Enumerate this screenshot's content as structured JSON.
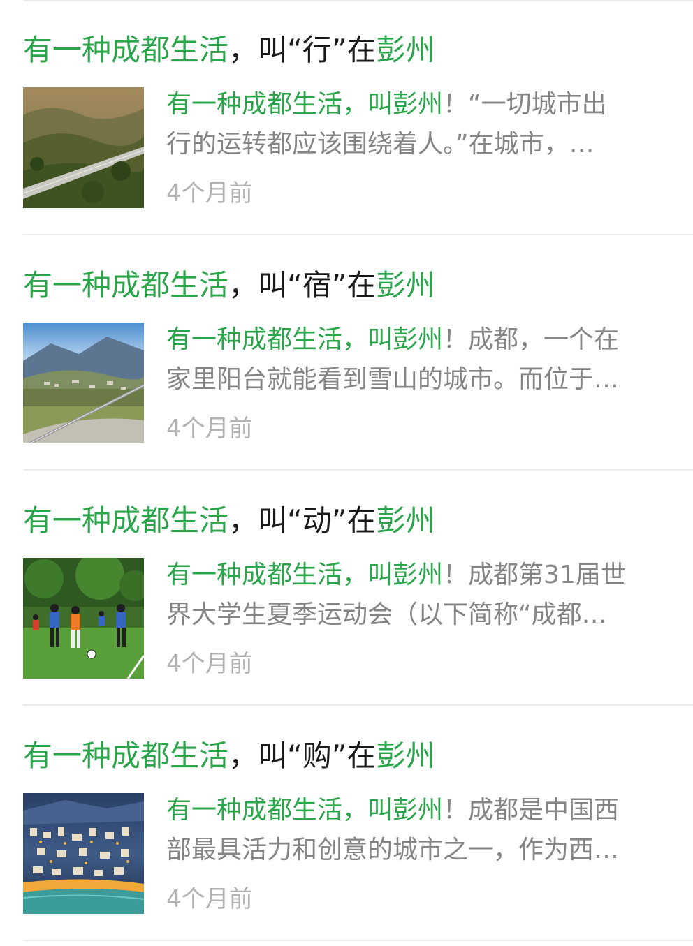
{
  "articles": [
    {
      "title": {
        "green1": "有一种成都生活",
        "dark1": "，叫“",
        "keyword": "行",
        "dark2": "”在",
        "green2": "彭州"
      },
      "desc": {
        "green": "有一种成都生活，叫彭州",
        "line1_rest": "！“一切城市出",
        "line2": "行的运转都应该围绕着人。”在城市，…"
      },
      "time": "4个月前",
      "thumb_icon": "highway-mountain-photo"
    },
    {
      "title": {
        "green1": "有一种成都生活",
        "dark1": "，叫“",
        "keyword": "宿",
        "dark2": "”在",
        "green2": "彭州"
      },
      "desc": {
        "green": "有一种成都生活，叫彭州",
        "line1_rest": "！成都，一个在",
        "line2": "家里阳台就能看到雪山的城市。而位于…"
      },
      "time": "4个月前",
      "thumb_icon": "valley-village-photo"
    },
    {
      "title": {
        "green1": "有一种成都生活",
        "dark1": "，叫“",
        "keyword": "动",
        "dark2": "”在",
        "green2": "彭州"
      },
      "desc": {
        "green": "有一种成都生活，叫彭州",
        "line1_rest": "！成都第31届世",
        "line2": "界大学生夏季运动会（以下简称“成都…"
      },
      "time": "4个月前",
      "thumb_icon": "football-game-photo"
    },
    {
      "title": {
        "green1": "有一种成都生活",
        "dark1": "，叫“",
        "keyword": "购",
        "dark2": "”在",
        "green2": "彭州"
      },
      "desc": {
        "green": "有一种成都生活，叫彭州",
        "line1_rest": "！成都是中国西",
        "line2": "部最具活力和创意的城市之一，作为西…"
      },
      "time": "4个月前",
      "thumb_icon": "night-city-photo"
    }
  ]
}
